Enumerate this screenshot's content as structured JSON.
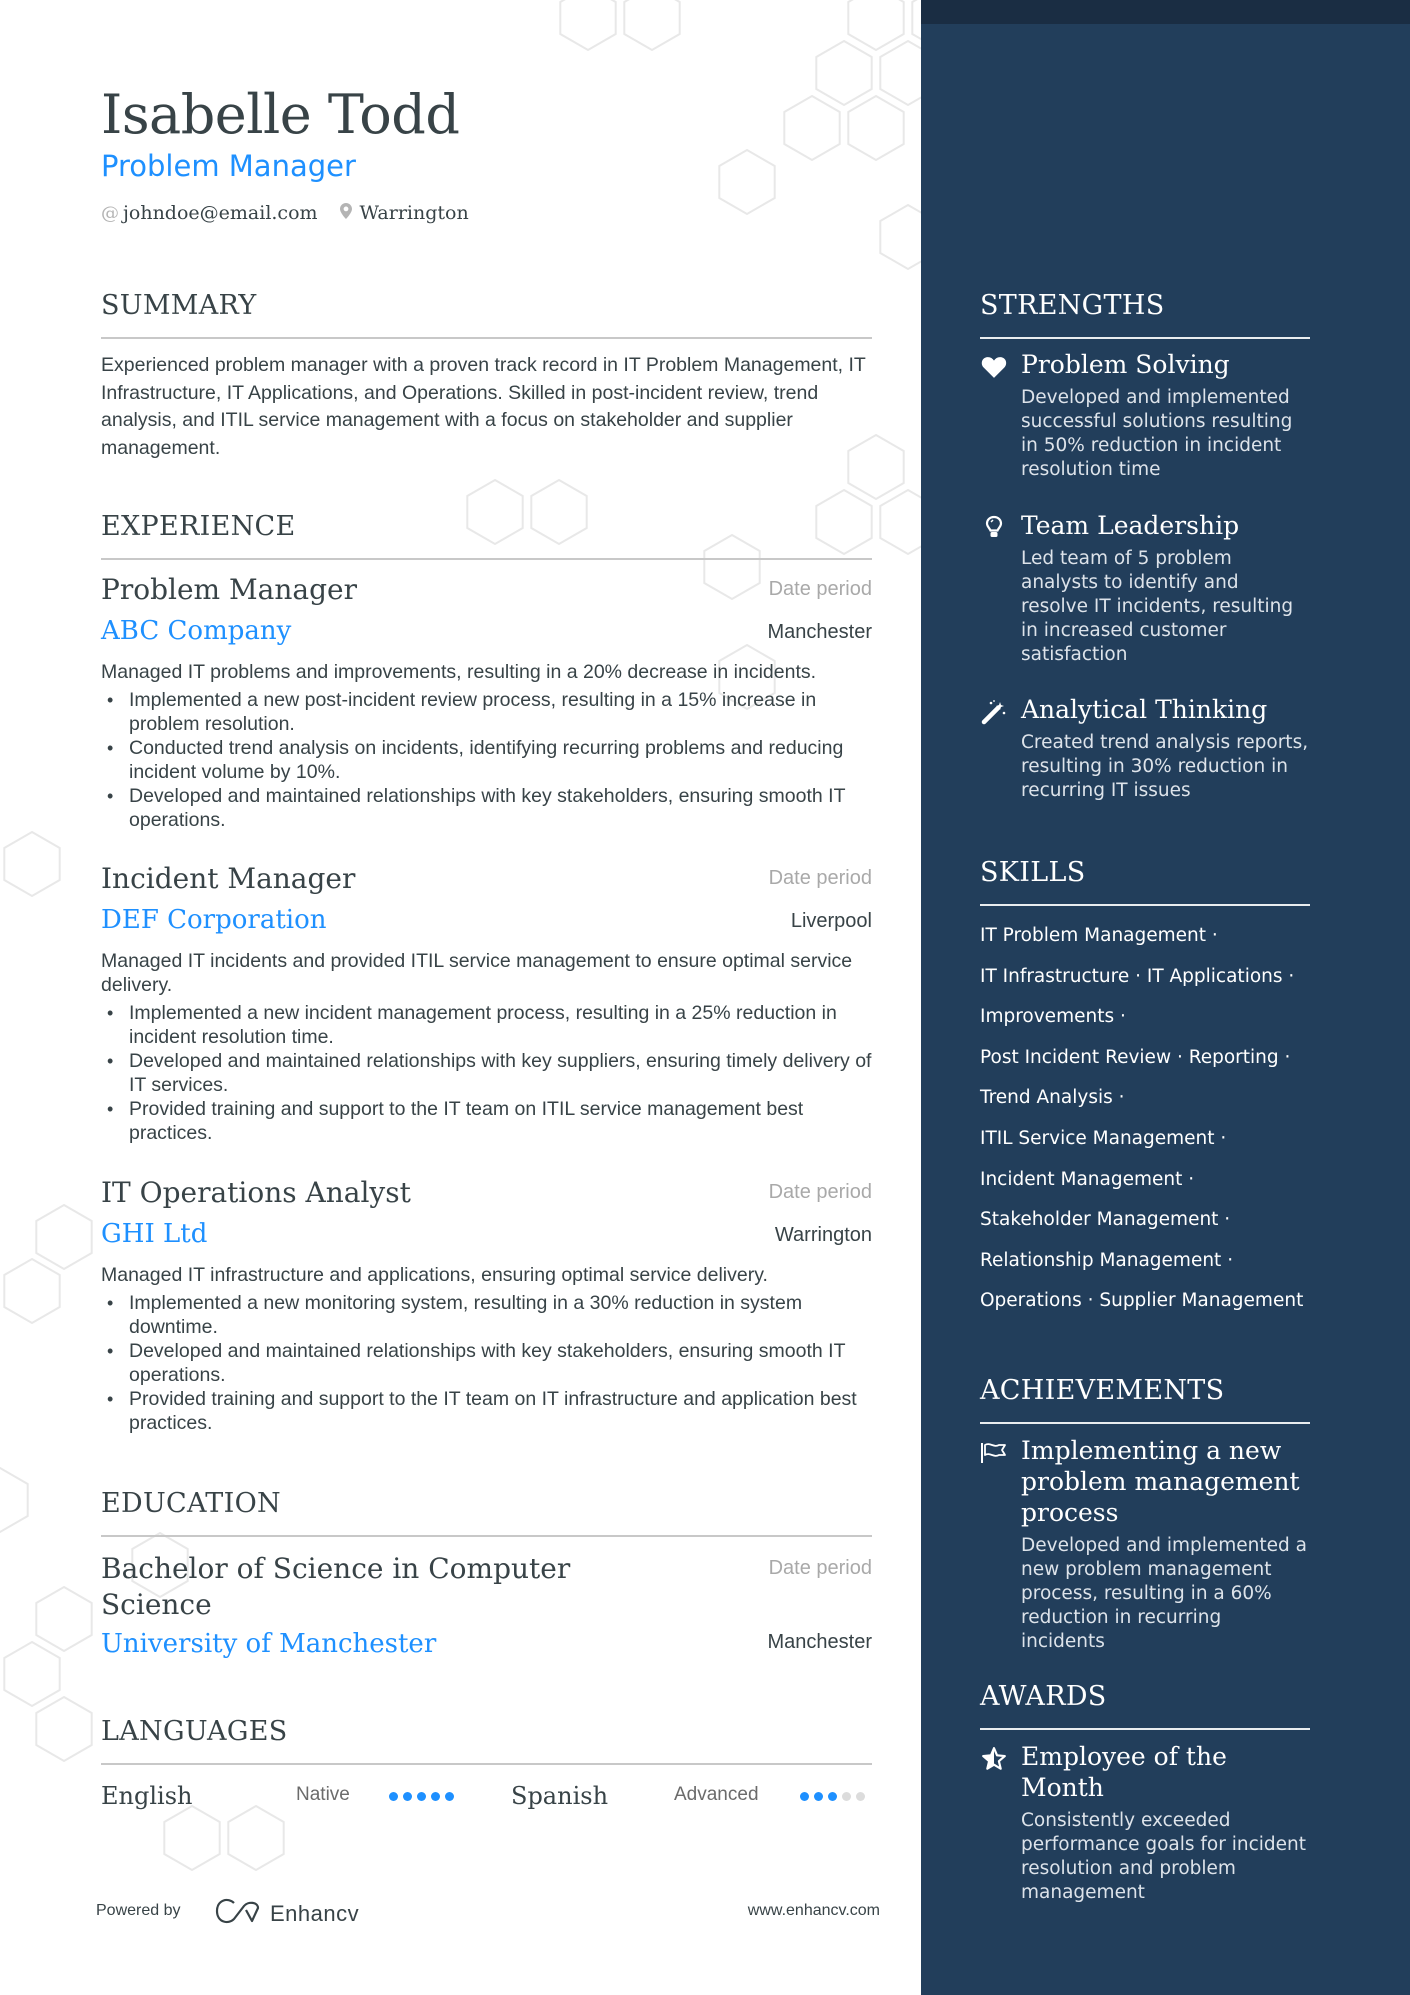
{
  "header": {
    "name": "Isabelle Todd",
    "role": "Problem Manager",
    "email": "johndoe@email.com",
    "location": "Warrington",
    "email_icon": "at-icon",
    "location_icon": "map-pin-icon"
  },
  "summary": {
    "title": "SUMMARY",
    "text": "Experienced problem manager with a proven track record in IT Problem Management, IT Infrastructure, IT Applications, and Operations. Skilled in post-incident review, trend analysis, and ITIL service management with a focus on stakeholder and supplier management."
  },
  "experience": {
    "title": "EXPERIENCE",
    "items": [
      {
        "title": "Problem Manager",
        "company": "ABC Company",
        "date": "Date period",
        "location": "Manchester",
        "description": "Managed IT problems and improvements, resulting in a 20% decrease in incidents.",
        "bullets": [
          "Implemented a new post-incident review process, resulting in a 15% increase in problem resolution.",
          "Conducted trend analysis on incidents, identifying recurring problems and reducing incident volume by 10%.",
          "Developed and maintained relationships with key stakeholders, ensuring smooth IT operations."
        ]
      },
      {
        "title": "Incident Manager",
        "company": "DEF Corporation",
        "date": "Date period",
        "location": "Liverpool",
        "description": "Managed IT incidents and provided ITIL service management to ensure optimal service delivery.",
        "bullets": [
          "Implemented a new incident management process, resulting in a 25% reduction in incident resolution time.",
          "Developed and maintained relationships with key suppliers, ensuring timely delivery of IT services.",
          "Provided training and support to the IT team on ITIL service management best practices."
        ]
      },
      {
        "title": "IT Operations Analyst",
        "company": "GHI Ltd",
        "date": "Date period",
        "location": "Warrington",
        "description": "Managed IT infrastructure and applications, ensuring optimal service delivery.",
        "bullets": [
          "Implemented a new monitoring system, resulting in a 30% reduction in system downtime.",
          "Developed and maintained relationships with key stakeholders, ensuring smooth IT operations.",
          "Provided training and support to the IT team on IT infrastructure and application best practices."
        ]
      }
    ]
  },
  "education": {
    "title": "EDUCATION",
    "items": [
      {
        "degree": "Bachelor of Science in Computer Science",
        "school": "University of Manchester",
        "date": "Date period",
        "location": "Manchester"
      }
    ]
  },
  "languages": {
    "title": "LANGUAGES",
    "items": [
      {
        "name": "English",
        "level": "Native",
        "rating": 5,
        "max": 5
      },
      {
        "name": "Spanish",
        "level": "Advanced",
        "rating": 3,
        "max": 5
      }
    ]
  },
  "footer": {
    "powered_by": "Powered by",
    "brand": "Enhancv",
    "website": "www.enhancv.com"
  },
  "strengths": {
    "title": "STRENGTHS",
    "items": [
      {
        "icon": "heart-icon",
        "title": "Problem Solving",
        "description": "Developed and implemented successful solutions resulting in 50% reduction in incident resolution time"
      },
      {
        "icon": "lightbulb-icon",
        "title": "Team Leadership",
        "description": "Led team of 5 problem analysts to identify and resolve IT incidents, resulting in increased customer satisfaction"
      },
      {
        "icon": "magic-wand-icon",
        "title": "Analytical Thinking",
        "description": "Created trend analysis reports, resulting in 30% reduction in recurring IT issues"
      }
    ]
  },
  "skills": {
    "title": "SKILLS",
    "lines": [
      "IT Problem Management ·",
      "IT Infrastructure · IT Applications ·",
      "Improvements ·",
      "Post Incident Review · Reporting ·",
      "Trend Analysis ·",
      "ITIL Service Management ·",
      "Incident Management ·",
      "Stakeholder Management ·",
      "Relationship Management ·",
      "Operations · Supplier Management"
    ]
  },
  "achievements": {
    "title": "ACHIEVEMENTS",
    "items": [
      {
        "icon": "flag-icon",
        "title": "Implementing a new problem management process",
        "description": "Developed and implemented a new problem management process, resulting in a 60% reduction in recurring incidents"
      }
    ]
  },
  "awards": {
    "title": "AWARDS",
    "items": [
      {
        "icon": "star-icon",
        "title": "Employee of the Month",
        "description": "Consistently exceeded performance goals for incident resolution and problem management"
      }
    ]
  },
  "colors": {
    "accent": "#1e90ff",
    "sidebar": "#223e5b",
    "sidebar_strip": "#1a2d43",
    "text": "#384347",
    "muted": "#a9a9a9"
  }
}
